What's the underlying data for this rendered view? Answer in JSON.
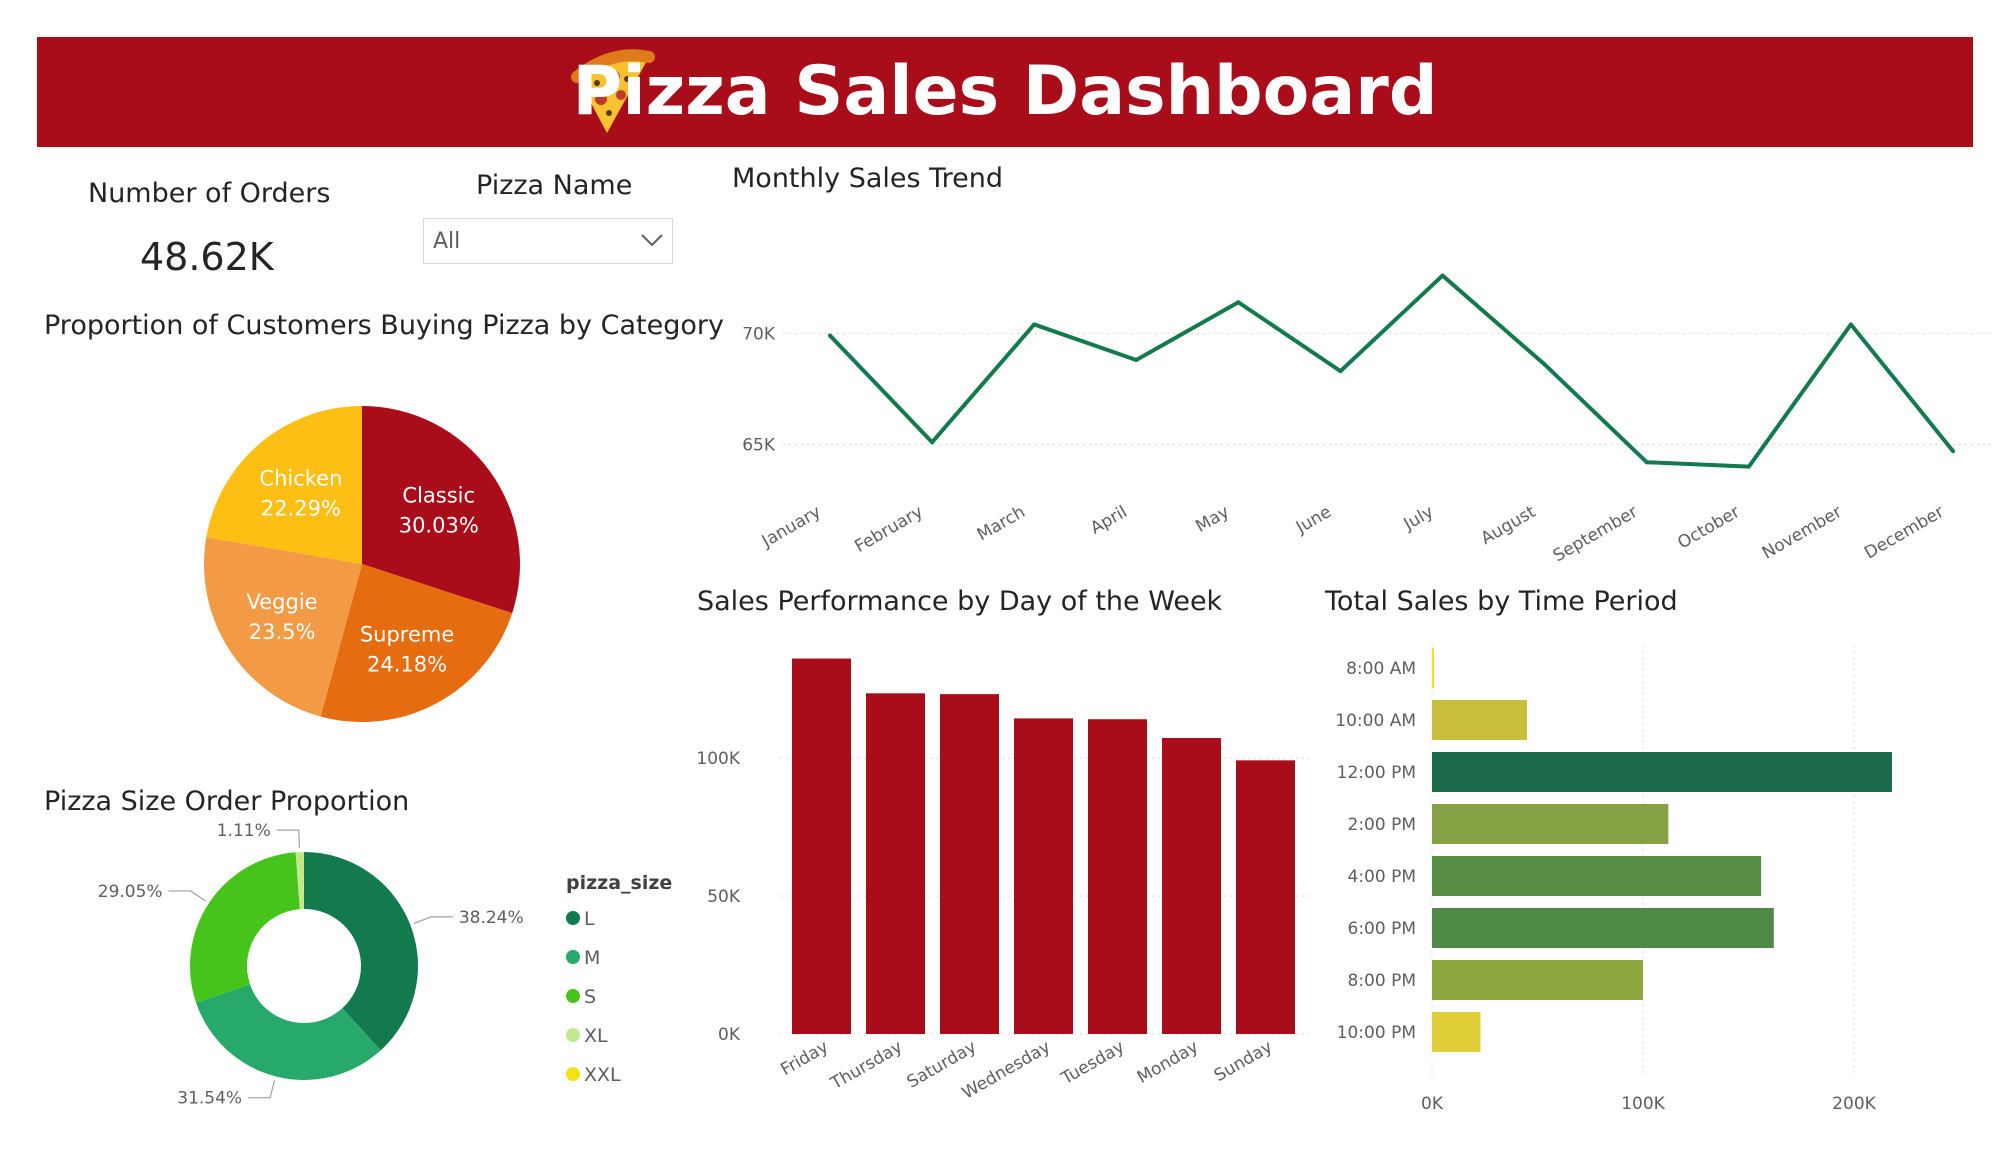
{
  "header": {
    "title": "Pizza Sales Dashboard",
    "logo_icon": "pizza-slice-icon",
    "background": "#a90d1a"
  },
  "kpi": {
    "label": "Number of Orders",
    "value": "48.62K"
  },
  "slicer": {
    "label": "Pizza Name",
    "selected": "All"
  },
  "chart_data": [
    {
      "id": "category-pie",
      "type": "pie",
      "title": "Proportion of Customers Buying Pizza by Category",
      "categories": [
        "Classic",
        "Supreme",
        "Veggie",
        "Chicken"
      ],
      "values": [
        30.03,
        24.18,
        23.5,
        22.29
      ],
      "labels": [
        "30.03%",
        "24.18%",
        "23.5%",
        "22.29%"
      ],
      "colors": [
        "#a90d1a",
        "#e66c10",
        "#f39a45",
        "#fdbf13"
      ]
    },
    {
      "id": "size-donut",
      "type": "pie",
      "title": "Pizza Size Order Proportion",
      "legend_title": "pizza_size",
      "legend_position": "right",
      "categories": [
        "L",
        "M",
        "S",
        "XL",
        "XXL"
      ],
      "values": [
        38.24,
        31.54,
        29.05,
        1.11,
        0.06
      ],
      "labels": [
        "38.24%",
        "31.54%",
        "29.05%",
        "1.11%",
        ""
      ],
      "colors": [
        "#137a4e",
        "#26a96b",
        "#47c41b",
        "#c2e88e",
        "#f3e214"
      ]
    },
    {
      "id": "monthly-line",
      "type": "line",
      "title": "Monthly Sales Trend",
      "x": [
        "January",
        "February",
        "March",
        "April",
        "May",
        "June",
        "July",
        "August",
        "September",
        "October",
        "November",
        "December"
      ],
      "values": [
        69900,
        65100,
        70400,
        68800,
        71400,
        68300,
        72600,
        68600,
        64200,
        64000,
        70400,
        64700
      ],
      "yticks": [
        65000,
        70000
      ],
      "ytick_labels": [
        "65K",
        "70K"
      ],
      "ylim": [
        62500,
        74200
      ],
      "color": "#137a4e",
      "grid": true
    },
    {
      "id": "weekday-bar",
      "type": "bar",
      "title": "Sales Performance by Day of the Week",
      "categories": [
        "Friday",
        "Thursday",
        "Saturday",
        "Wednesday",
        "Tuesday",
        "Monday",
        "Sunday"
      ],
      "values": [
        136100,
        123500,
        123200,
        114400,
        114100,
        107300,
        99200
      ],
      "yticks": [
        0,
        50000,
        100000
      ],
      "ytick_labels": [
        "0K",
        "50K",
        "100K"
      ],
      "ylim": [
        0,
        145000
      ],
      "color": "#a90d1a",
      "grid": true
    },
    {
      "id": "time-hbar",
      "type": "bar",
      "orientation": "horizontal",
      "title": "Total Sales by Time Period",
      "categories": [
        "8:00 AM",
        "10:00 AM",
        "12:00 PM",
        "2:00 PM",
        "4:00 PM",
        "6:00 PM",
        "8:00 PM",
        "10:00 PM"
      ],
      "values": [
        800,
        45000,
        218000,
        112000,
        156000,
        162000,
        100000,
        23000
      ],
      "colors": [
        "#f3e214",
        "#c8c03c",
        "#1c6b4a",
        "#84a143",
        "#588e44",
        "#4f8a46",
        "#8ea63e",
        "#dfce38"
      ],
      "xticks": [
        0,
        100000,
        200000
      ],
      "xtick_labels": [
        "0K",
        "100K",
        "200K"
      ],
      "xlim": [
        0,
        240000
      ],
      "grid": true
    }
  ]
}
